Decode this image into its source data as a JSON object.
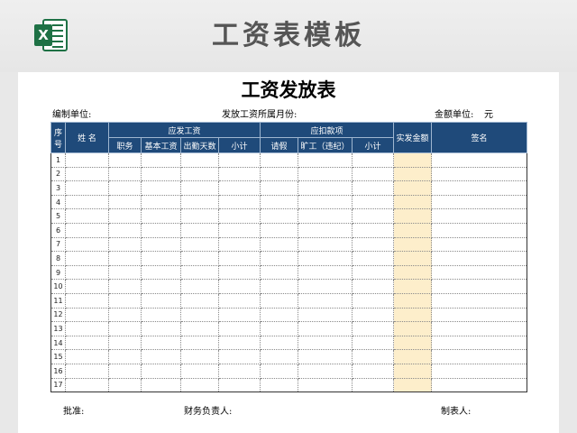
{
  "page_title": "工资表模板",
  "sheet": {
    "title": "工资发放表",
    "meta_unit": "编制单位:",
    "meta_month": "发放工资所属月份:",
    "meta_amount_unit": "金额单位:",
    "meta_currency": "元"
  },
  "table": {
    "headers": {
      "index": "序号",
      "name": "姓 名",
      "payable_group": "应发工资",
      "position": "职务",
      "base_salary": "基本工资",
      "attendance_days": "出勤天数",
      "subtotal1": "小计",
      "deduction_group": "应扣款项",
      "leave": "请假",
      "absence": "旷工（违纪）",
      "subtotal2": "小计",
      "actual_pay": "实发金额",
      "signature": "签名"
    },
    "rows": [
      "1",
      "2",
      "3",
      "4",
      "5",
      "6",
      "7",
      "8",
      "9",
      "10",
      "11",
      "12",
      "13",
      "14",
      "15",
      "16",
      "17"
    ]
  },
  "footer": {
    "approved": "批准:",
    "finance_head": "财务负责人:",
    "preparer": "制表人:"
  },
  "colors": {
    "header_bg": "#1f4a7a",
    "actual_pay_bg": "#fdeecb",
    "excel_green": "#1e7145"
  }
}
